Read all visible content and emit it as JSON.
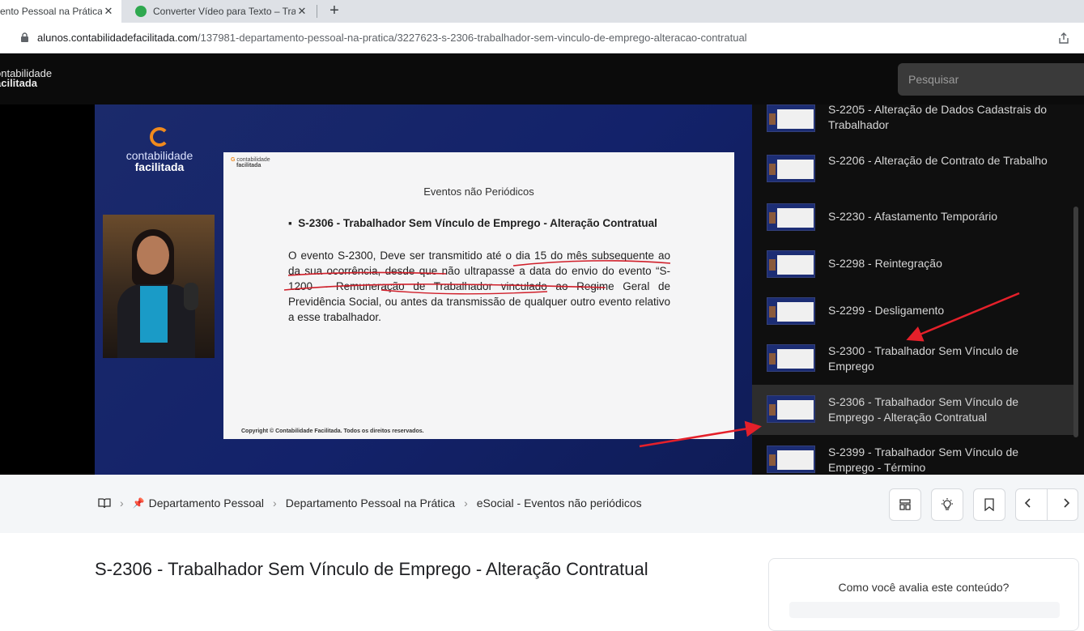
{
  "browser": {
    "tabs": [
      {
        "title": "ento Pessoal na Prática",
        "active": true
      },
      {
        "title": "Converter Vídeo para Texto – Tran",
        "active": false
      }
    ],
    "url_domain": "alunos.contabilidadefacilitada.com",
    "url_path": "/137981-departamento-pessoal-na-pratica/3227623-s-2306-trabalhador-sem-vinculo-de-emprego-alteracao-contratual"
  },
  "site": {
    "logo_line1": "ontabilidade",
    "logo_line2": "acilitada",
    "search_placeholder": "Pesquisar"
  },
  "video": {
    "brand_line1": "contabilidade",
    "brand_line2": "facilitada",
    "slide": {
      "logo_line1": "contabilidade",
      "logo_line2": "facilitada",
      "heading": "Eventos não Periódicos",
      "bullet": "S-2306 - Trabalhador Sem Vínculo de Emprego - Alteração Contratual",
      "paragraph": "O evento S-2300, Deve ser transmitido até o dia 15 do mês subsequente ao da sua ocorrência, desde que não ultrapasse a data do envio do evento “S-1200 – Remuneração de Trabalhador vinculado ao Regime Geral de Previdência Social, ou antes da transmissão de qualquer outro evento relativo a esse trabalhador.",
      "copyright": "Copyright © Contabilidade Facilitada. Todos os direitos reservados."
    }
  },
  "playlist": {
    "items": [
      {
        "title": "S-2205 - Alteração de Dados Cadastrais do Trabalhador",
        "active": false
      },
      {
        "title": "S-2206 - Alteração de Contrato de Trabalho",
        "active": false
      },
      {
        "title": "S-2230 - Afastamento Temporário",
        "active": false
      },
      {
        "title": "S-2298 - Reintegração",
        "active": false
      },
      {
        "title": "S-2299 - Desligamento",
        "active": false
      },
      {
        "title": "S-2300 - Trabalhador Sem Vínculo de Emprego",
        "active": false
      },
      {
        "title": "S-2306 - Trabalhador Sem Vínculo de Emprego - Alteração Contratual",
        "active": true
      },
      {
        "title": "S-2399 - Trabalhador Sem Vínculo de Emprego - Término",
        "active": false
      }
    ]
  },
  "breadcrumb": {
    "items": [
      "Departamento Pessoal",
      "Departamento Pessoal na Prática",
      "eSocial - Eventos não periódicos"
    ]
  },
  "toolbar_icons": [
    "layout-icon",
    "lightbulb-icon",
    "bookmark-icon",
    "chevron-left-icon",
    "chevron-right-icon"
  ],
  "content": {
    "title": "S-2306 - Trabalhador Sem Vínculo de Emprego - Alteração Contratual"
  },
  "rating": {
    "question": "Como você avalia este conteúdo?"
  },
  "colors": {
    "annotation_red": "#e5202a",
    "brand_orange": "#f08a1d",
    "video_blue": "#13226a"
  }
}
